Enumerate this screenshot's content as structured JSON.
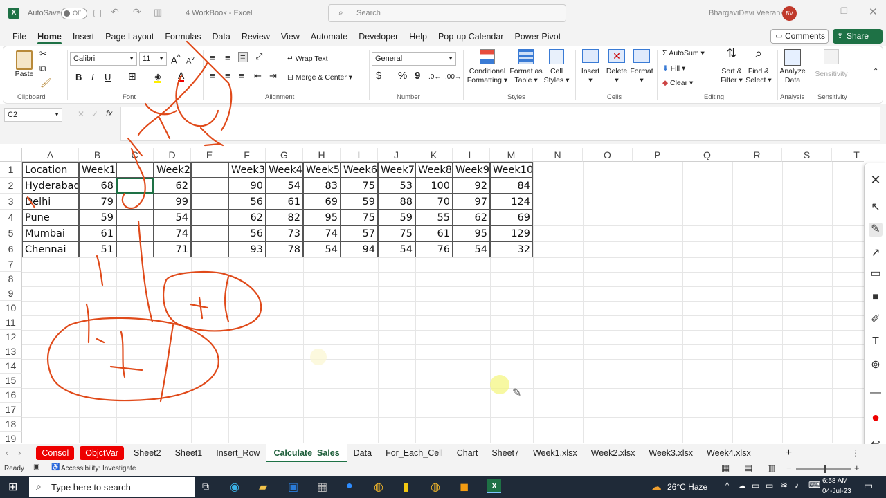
{
  "titlebar": {
    "autosave_label": "AutoSave",
    "autosave_state": "Off",
    "doc_title": "4 WorkBook  -  Excel",
    "search_placeholder": "Search",
    "user_name": "BhargaviDevi Veeranki",
    "user_initials": "BV"
  },
  "menu": [
    "File",
    "Home",
    "Insert",
    "Page Layout",
    "Formulas",
    "Data",
    "Review",
    "View",
    "Automate",
    "Developer",
    "Help",
    "Pop-up Calendar",
    "Power Pivot"
  ],
  "menu_active": "Home",
  "comments_label": "Comments",
  "share_label": "Share",
  "ribbon": {
    "clipboard": {
      "paste": "Paste",
      "label": "Clipboard"
    },
    "font": {
      "name": "Calibri",
      "size": "11",
      "label": "Font",
      "bold": "B",
      "italic": "I",
      "underline": "U"
    },
    "alignment": {
      "wrap": "Wrap Text",
      "merge": "Merge & Center",
      "label": "Alignment"
    },
    "number": {
      "format": "General",
      "currency": "$",
      "percent": "%",
      "comma": "9",
      "label": "Number"
    },
    "styles": {
      "cond": "Conditional",
      "cond2": "Formatting",
      "fmt_table": "Format as",
      "fmt_table2": "Table",
      "cell_styles": "Cell",
      "cell_styles2": "Styles",
      "label": "Styles"
    },
    "cells": {
      "insert": "Insert",
      "delete": "Delete",
      "format": "Format",
      "label": "Cells"
    },
    "editing": {
      "autosum": "AutoSum",
      "fill": "Fill",
      "clear": "Clear",
      "sort": "Sort &",
      "sort2": "Filter",
      "find": "Find &",
      "find2": "Select",
      "label": "Editing"
    },
    "analysis": {
      "analyze": "Analyze",
      "analyze2": "Data",
      "label": "Analysis"
    },
    "sensitivity": {
      "btn": "Sensitivity",
      "label": "Sensitivity"
    }
  },
  "formula_bar": {
    "name_box": "C2",
    "fx": "fx",
    "content": ""
  },
  "columns": [
    "A",
    "B",
    "C",
    "D",
    "E",
    "F",
    "G",
    "H",
    "I",
    "J",
    "K",
    "L",
    "M",
    "N",
    "O",
    "P",
    "Q",
    "R",
    "S",
    "T"
  ],
  "rows": [
    "1",
    "2",
    "3",
    "4",
    "5",
    "6",
    "7",
    "8",
    "9",
    "10",
    "11",
    "12",
    "13",
    "14",
    "15",
    "16",
    "17",
    "18",
    "19"
  ],
  "table": {
    "header": [
      "Location",
      "Week1",
      "",
      "Week2",
      "",
      "Week3",
      "Week4",
      "Week5",
      "Week6",
      "Week7",
      "Week8",
      "Week9",
      "Week10"
    ],
    "data": [
      [
        "Hyderabad",
        "68",
        "",
        "62",
        "",
        "90",
        "54",
        "83",
        "75",
        "53",
        "100",
        "92",
        "84"
      ],
      [
        "Delhi",
        "79",
        "",
        "99",
        "",
        "56",
        "61",
        "69",
        "59",
        "88",
        "70",
        "97",
        "124"
      ],
      [
        "Pune",
        "59",
        "",
        "54",
        "",
        "62",
        "82",
        "95",
        "75",
        "59",
        "55",
        "62",
        "69"
      ],
      [
        "Mumbai",
        "61",
        "",
        "74",
        "",
        "56",
        "73",
        "74",
        "57",
        "75",
        "61",
        "95",
        "129"
      ],
      [
        "Chennai",
        "51",
        "",
        "71",
        "",
        "93",
        "78",
        "54",
        "94",
        "54",
        "76",
        "54",
        "32"
      ]
    ]
  },
  "sheet_tabs": [
    "Consol",
    "ObjctVar",
    "Sheet2",
    "Sheet1",
    "Insert_Row",
    "Calculate_Sales",
    "Data",
    "For_Each_Cell",
    "Chart",
    "Sheet7",
    "Week1.xlsx",
    "Week2.xlsx",
    "Week3.xlsx",
    "Week4.xlsx"
  ],
  "active_tab": "Calculate_Sales",
  "status": {
    "ready": "Ready",
    "accessibility": "Accessibility: Investigate"
  },
  "taskbar": {
    "search": "Type here to search",
    "weather": "26°C  Haze",
    "time": "6:58 AM",
    "date": "04-Jul-23"
  },
  "colors": {
    "excel_green": "#1e7145",
    "annotation": "#e04a1a",
    "red_tab": "#ee0000"
  }
}
